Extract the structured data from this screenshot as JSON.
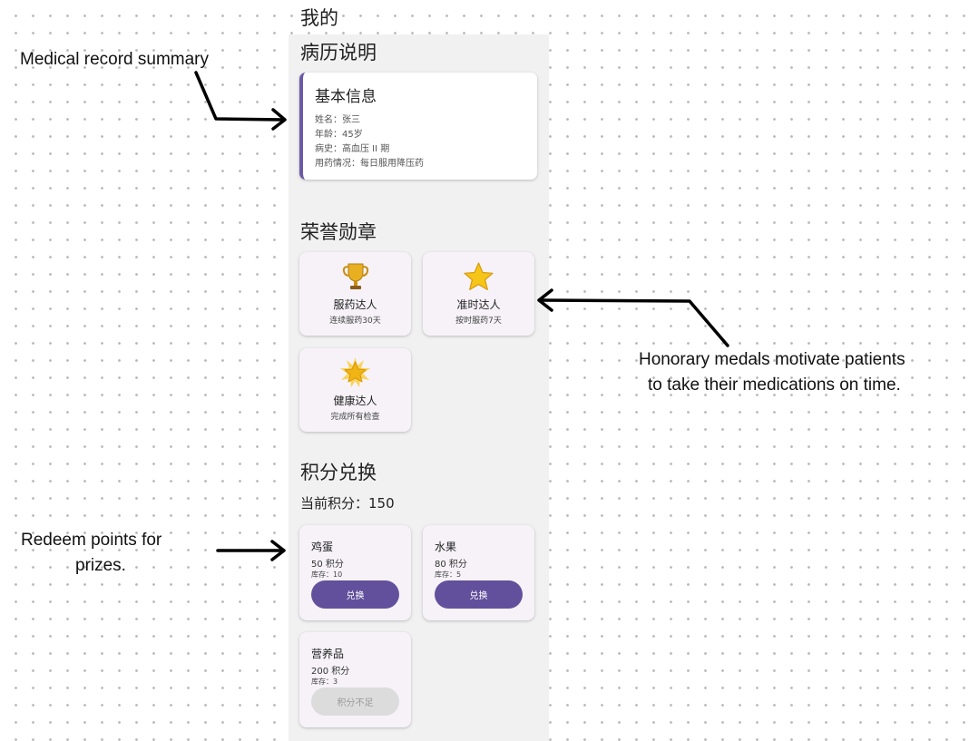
{
  "page_title": "我的",
  "record": {
    "section_title": "病历说明",
    "card_title": "基本信息",
    "rows": [
      "姓名：张三",
      "年龄：45岁",
      "病史：高血压 II 期",
      "用药情况：每日服用降压药"
    ]
  },
  "medals": {
    "section_title": "荣誉勋章",
    "items": [
      {
        "icon": "trophy-icon",
        "name": "服药达人",
        "desc": "连续服药30天"
      },
      {
        "icon": "star-icon",
        "name": "准时达人",
        "desc": "按时服药7天"
      },
      {
        "icon": "glowing-star-icon",
        "name": "健康达人",
        "desc": "完成所有检查"
      }
    ]
  },
  "points": {
    "section_title": "积分兑换",
    "current_label": "当前积分：150",
    "prizes": [
      {
        "name": "鸡蛋",
        "cost": "50 积分",
        "stock": "库存：10",
        "button": "兑换",
        "enabled": true
      },
      {
        "name": "水果",
        "cost": "80 积分",
        "stock": "库存：5",
        "button": "兑换",
        "enabled": true
      },
      {
        "name": "营养品",
        "cost": "200 积分",
        "stock": "库存：3",
        "button": "积分不足",
        "enabled": false
      }
    ]
  },
  "annotations": {
    "record": "Medical record summary",
    "medals_line1": "Honorary medals motivate patients",
    "medals_line2": "to take their medications on time.",
    "points_line1": "Redeem points for",
    "points_line2": "prizes."
  },
  "colors": {
    "accent": "#63509c",
    "card": "#f6f2f8",
    "disabled": "#dcdcdc"
  }
}
